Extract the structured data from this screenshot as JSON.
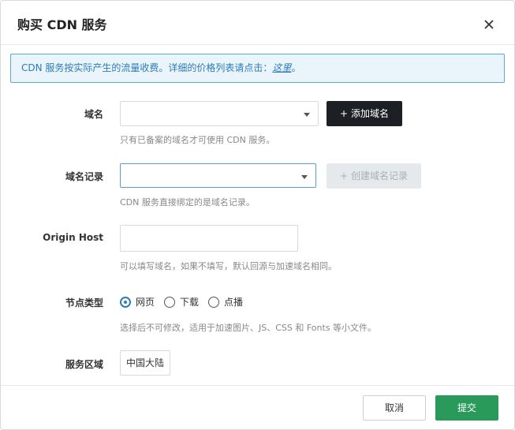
{
  "dialog": {
    "title": "购买 CDN 服务"
  },
  "notice": {
    "text": "CDN 服务按实际产生的流量收费。详细的价格列表请点击：",
    "link": "这里",
    "suffix": "。"
  },
  "domain": {
    "label": "域名",
    "value": "",
    "add_button": "添加域名",
    "hint": "只有已备案的域名才可使用 CDN 服务。"
  },
  "record": {
    "label": "域名记录",
    "value": "",
    "create_button": "创建域名记录",
    "hint": "CDN 服务直接绑定的是域名记录。"
  },
  "origin": {
    "label": "Origin Host",
    "value": "",
    "hint": "可以填写域名，如果不填写，默认回源与加速域名相同。"
  },
  "node_type": {
    "label": "节点类型",
    "options": [
      "网页",
      "下载",
      "点播"
    ],
    "selected": "网页",
    "hint": "选择后不可修改，适用于加速图片、JS、CSS 和 Fonts 等小文件。"
  },
  "region": {
    "label": "服务区域",
    "selected": "中国大陆"
  },
  "footer": {
    "cancel": "取消",
    "submit": "提交"
  },
  "colors": {
    "accent": "#2b7bb9",
    "submit": "#2a9a5b",
    "dark_button": "#1c2024"
  }
}
